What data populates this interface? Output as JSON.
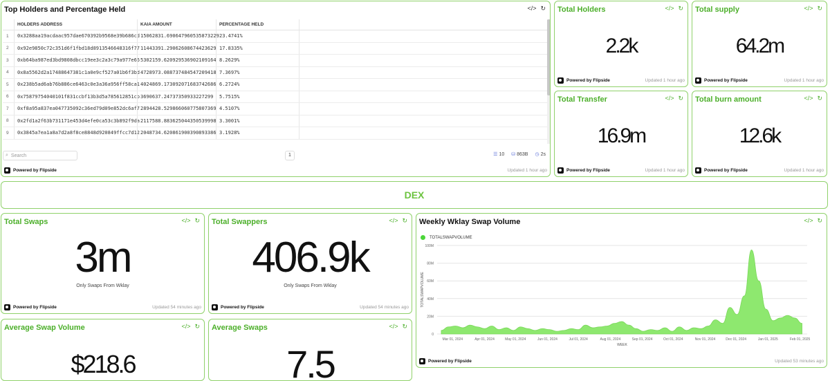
{
  "holders_card": {
    "title": "Top Holders and Percentage Held",
    "columns": [
      "HOLDERS ADDRESS",
      "KAIA AMOUNT",
      "PERCENTAGE HELD"
    ],
    "rows": [
      {
        "n": "1",
        "address": "0x3288aa19acdaac957dae670392b9568e39b686cd",
        "amount": "15062831.690647960535873229",
        "pct": "23.4741%"
      },
      {
        "n": "2",
        "address": "0x92e9850c72c351d6f1fbd18d8913546648316f77",
        "amount": "11443391.29062608674423629",
        "pct": "17.8335%"
      },
      {
        "n": "3",
        "address": "0xb64ba987ed3bd9808dbcc19ee3c2a3c79a977e66",
        "amount": "5302159.620929536902109164",
        "pct": "8.2629%"
      },
      {
        "n": "4",
        "address": "0x8a5562d2a17488647381c1a0e9cf527a01b6f3bd",
        "amount": "4728973.088737484547209418",
        "pct": "7.3697%"
      },
      {
        "n": "5",
        "address": "0x238b5ad6ab76b886ce6463c0e3a36a956ff58ca1",
        "amount": "4024869.173092071683742686",
        "pct": "6.2724%"
      },
      {
        "n": "6",
        "address": "0x75879754040101f831ccbf13b3d5a785612851cb",
        "amount": "3690637.24737350933227299",
        "pct": "5.7515%"
      },
      {
        "n": "7",
        "address": "0xf8a95a837ea047735092c36ed79d09e852dc6af7",
        "amount": "2894428.529866060775807369",
        "pct": "4.5107%"
      },
      {
        "n": "8",
        "address": "0x2fd1a2f63b731171e453d4efe0ca53c3b892f9da",
        "amount": "2117588.883625044350539998",
        "pct": "3.3001%"
      },
      {
        "n": "9",
        "address": "0x3845a7ea1a8a7d2a8f8ce8848d920849ffcc7d12",
        "amount": "2048734.620861900390893386",
        "pct": "3.1928%"
      }
    ],
    "search_placeholder": "Search",
    "page": "1",
    "stat_rows": "10",
    "stat_size": "863B",
    "stat_time": "2s",
    "powered": "Powered by Flipside",
    "updated": "Updated 1 hour ago"
  },
  "stat_cards": {
    "total_holders": {
      "title": "Total Holders",
      "value": "2.2k",
      "powered": "Powered by Flipside",
      "updated": "Updated 1 hour ago"
    },
    "total_supply": {
      "title": "Total supply",
      "value": "64.2m",
      "powered": "Powered by Flipside",
      "updated": "Updated 1 hour ago"
    },
    "total_transfer": {
      "title": "Total Transfer",
      "value": "16.9m",
      "powered": "Powered by Flipside",
      "updated": "Updated 1 hour ago"
    },
    "total_burn": {
      "title": "Total burn amount",
      "value": "12.6k",
      "powered": "Powered by Flipside",
      "updated": "Updated 1 hour ago"
    },
    "total_swaps": {
      "title": "Total Swaps",
      "value": "3m",
      "subtitle": "Only Swaps From Wklay",
      "powered": "Powered by Flipside",
      "updated": "Updated 54 minutes ago"
    },
    "total_swappers": {
      "title": "Total Swappers",
      "value": "406.9k",
      "subtitle": "Only Swaps From Wklay",
      "powered": "Powered by Flipside",
      "updated": "Updated 54 minutes ago"
    },
    "avg_swap_volume": {
      "title": "Average Swap Volume",
      "value": "$218.6"
    },
    "avg_swaps": {
      "title": "Average Swaps",
      "value": "7.5"
    }
  },
  "section": {
    "title": "DEX"
  },
  "weekly_chart": {
    "title": "Weekly Wklay Swap Volume",
    "powered": "Powered by Flipside",
    "updated": "Updated 53 minutes ago"
  },
  "colors": {
    "border": "#8fd16a",
    "accent": "#4caf2a",
    "area": "#8ee86f",
    "legend_dot": "#4cd63a"
  },
  "icons": [
    "code-icon",
    "refresh-icon",
    "search-icon",
    "rows-icon",
    "database-icon",
    "clock-icon",
    "flipside-logo-icon"
  ],
  "chart_data": {
    "type": "area",
    "title": "",
    "xlabel": "WEEK",
    "ylabel": "TOTALSWAPVOLUME",
    "ylim": [
      0,
      100000000
    ],
    "yticks": [
      "0",
      "20M",
      "40M",
      "60M",
      "80M",
      "100M"
    ],
    "xticks": [
      "Mar 01, 2024",
      "Apr 01, 2024",
      "May 01, 2024",
      "Jun 01, 2024",
      "Jul 01, 2024",
      "Aug 01, 2024",
      "Sep 01, 2024",
      "Oct 01, 2024",
      "Nov 01, 2024",
      "Dec 01, 2024",
      "Jan 01, 2025",
      "Feb 01, 2025"
    ],
    "grid": true,
    "legend_position": "top-left",
    "series": [
      {
        "name": "TOTALSWAPVOLUME",
        "x": [
          "2024-02-19",
          "2024-02-26",
          "2024-03-04",
          "2024-03-11",
          "2024-03-18",
          "2024-03-25",
          "2024-04-01",
          "2024-04-08",
          "2024-04-15",
          "2024-04-22",
          "2024-04-29",
          "2024-05-06",
          "2024-05-13",
          "2024-05-20",
          "2024-05-27",
          "2024-06-03",
          "2024-06-10",
          "2024-06-17",
          "2024-06-24",
          "2024-07-01",
          "2024-07-08",
          "2024-07-15",
          "2024-07-22",
          "2024-07-29",
          "2024-08-05",
          "2024-08-12",
          "2024-08-19",
          "2024-08-26",
          "2024-09-02",
          "2024-09-09",
          "2024-09-16",
          "2024-09-23",
          "2024-09-30",
          "2024-10-07",
          "2024-10-14",
          "2024-10-21",
          "2024-10-28",
          "2024-11-04",
          "2024-11-11",
          "2024-11-18",
          "2024-11-25",
          "2024-12-02",
          "2024-12-09",
          "2024-12-16",
          "2024-12-23",
          "2024-12-30",
          "2025-01-06",
          "2025-01-13",
          "2025-01-20",
          "2025-01-27",
          "2025-02-03"
        ],
        "values": [
          4000000,
          8000000,
          9000000,
          7000000,
          10000000,
          8000000,
          6000000,
          9000000,
          5000000,
          7000000,
          4000000,
          8000000,
          6000000,
          4000000,
          6000000,
          5000000,
          3000000,
          4000000,
          6000000,
          5000000,
          10000000,
          7000000,
          8000000,
          9000000,
          12000000,
          14000000,
          10000000,
          6000000,
          3000000,
          5000000,
          4000000,
          7000000,
          3000000,
          8000000,
          4000000,
          7000000,
          6000000,
          9000000,
          16000000,
          12000000,
          30000000,
          22000000,
          43000000,
          95000000,
          60000000,
          28000000,
          15000000,
          18000000,
          21000000,
          18000000,
          12000000
        ]
      }
    ]
  }
}
